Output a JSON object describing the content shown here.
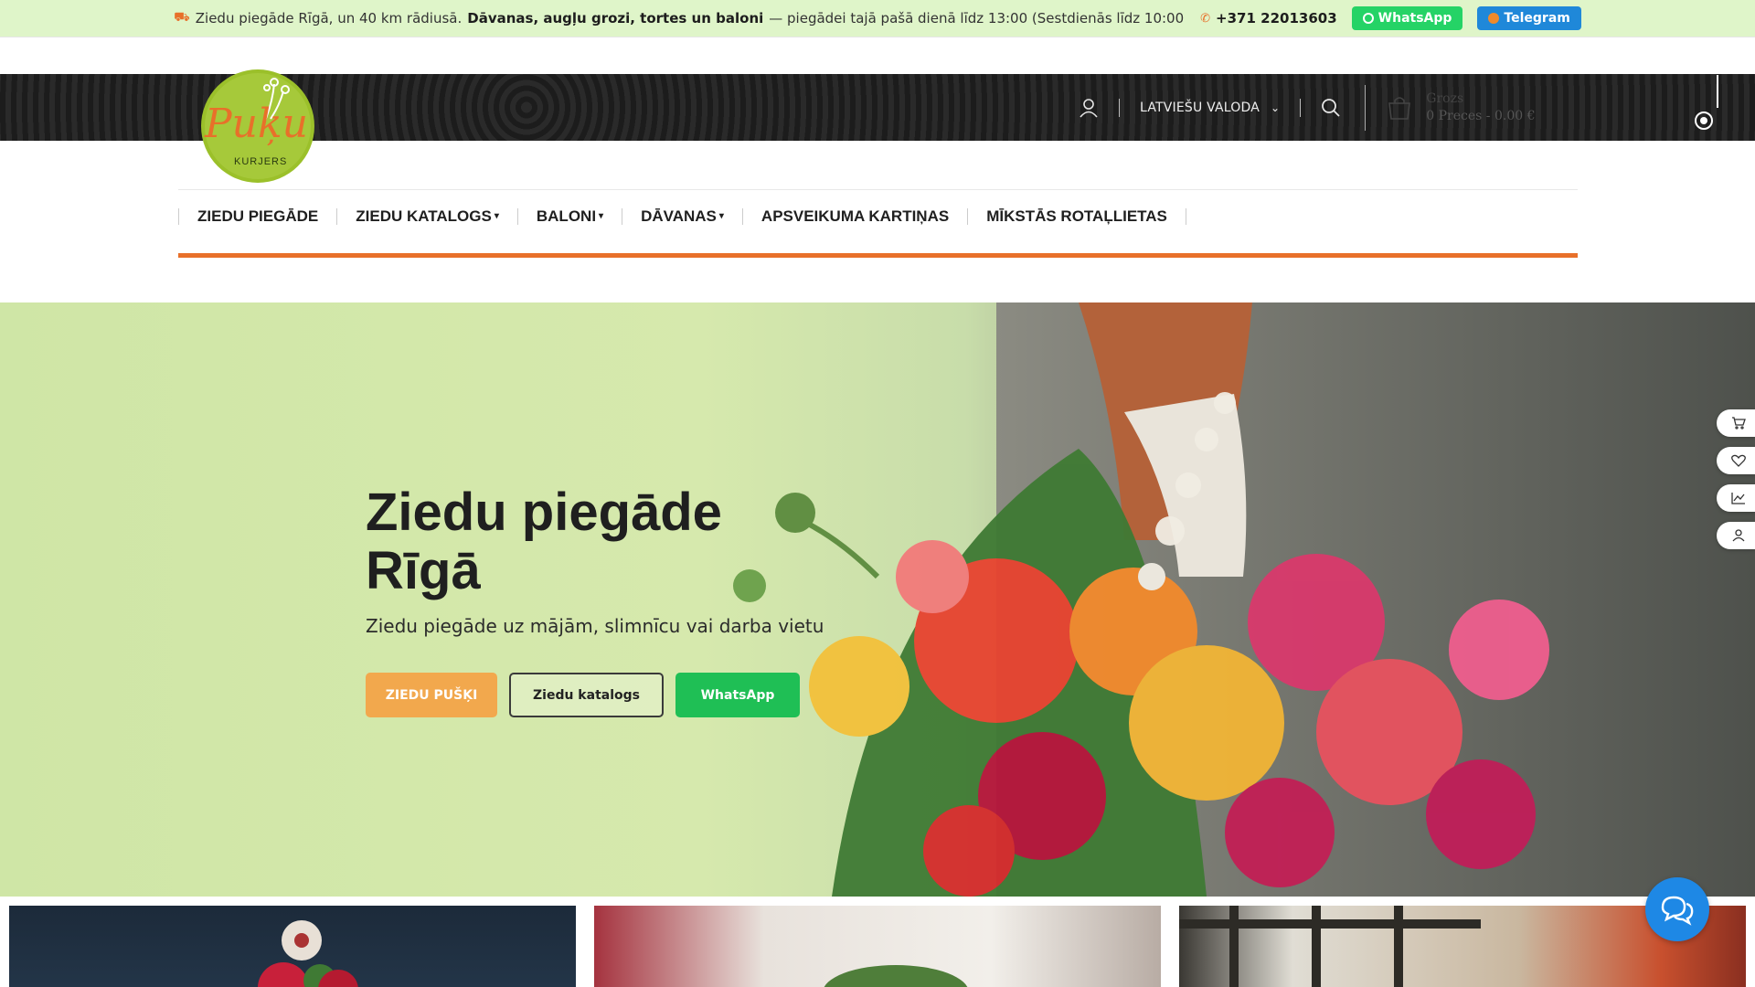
{
  "topbar": {
    "text_intro": "Ziedu piegāde Rīgā, un 40 km rādiusā.",
    "text_bold": "Dāvanas, augļu grozi, tortes un baloni",
    "text_delivery": "— piegādei tajā pašā dienā līdz 13:00 (Sestdienās līdz 10:00",
    "phone": "+371 22013603",
    "whatsapp_label": "WhatsApp",
    "telegram_label": "Telegram"
  },
  "logo": {
    "script_text": "Puķu",
    "sub_text": "KURJERS"
  },
  "header": {
    "language": "LATVIEŠU VALODA",
    "cart_title": "Grozs",
    "cart_summary": "0 Preces - 0.00 €"
  },
  "nav": {
    "items": [
      {
        "label": "ZIEDU PIEGĀDE",
        "dropdown": false
      },
      {
        "label": "ZIEDU KATALOGS",
        "dropdown": true
      },
      {
        "label": "BALONI",
        "dropdown": true
      },
      {
        "label": "DĀVANAS",
        "dropdown": true
      },
      {
        "label": "APSVEIKUMA KARTIŅAS",
        "dropdown": false
      },
      {
        "label": "MĪKSTĀS ROTAĻLIETAS",
        "dropdown": false
      }
    ]
  },
  "hero": {
    "title_line1": "Ziedu piegāde",
    "title_line2": "Rīgā",
    "subtitle": "Ziedu piegāde uz mājām, slimnīcu vai darba vietu",
    "btn_primary": "ZIEDU PUŠĶI",
    "btn_outline": "Ziedu katalogs",
    "btn_whatsapp": "WhatsApp"
  },
  "side_icons": [
    "cart-icon",
    "heart-icon",
    "compare-icon",
    "user-icon"
  ],
  "colors": {
    "accent": "#e8702a",
    "topbar_bg": "#dff5c9",
    "whatsapp": "#25d366",
    "telegram": "#1f88d9",
    "chat": "#1e88e5"
  }
}
